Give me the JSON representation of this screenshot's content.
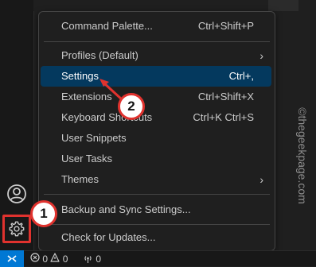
{
  "menu": {
    "items": [
      {
        "label": "Command Palette...",
        "shortcut": "Ctrl+Shift+P"
      },
      {
        "label": "Profiles (Default)",
        "submenu": "›"
      },
      {
        "label": "Settings",
        "shortcut": "Ctrl+,"
      },
      {
        "label": "Extensions",
        "shortcut": "Ctrl+Shift+X"
      },
      {
        "label": "Keyboard Shortcuts",
        "shortcut": "Ctrl+K Ctrl+S"
      },
      {
        "label": "User Snippets"
      },
      {
        "label": "User Tasks"
      },
      {
        "label": "Themes",
        "submenu": "›"
      },
      {
        "label": "Backup and Sync Settings..."
      },
      {
        "label": "Check for Updates..."
      }
    ]
  },
  "activity_bar": {
    "icons": [
      "account-icon",
      "gear-icon"
    ]
  },
  "status_bar": {
    "errors": "0",
    "warnings": "0",
    "ports": "0"
  },
  "annotations": {
    "step1": "1",
    "step2": "2"
  },
  "watermark": "©thegeekpage.com",
  "colors": {
    "menu_highlight": "#04395e",
    "annotation_red": "#e0322e",
    "remote_blue": "#0078d4"
  }
}
